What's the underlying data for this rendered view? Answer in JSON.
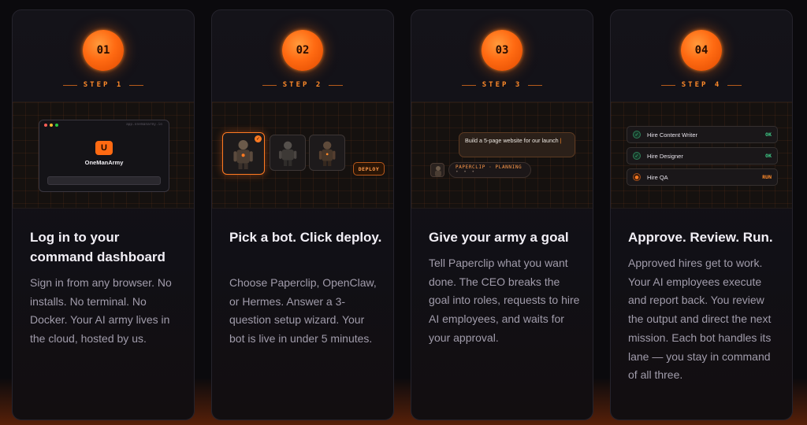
{
  "colors": {
    "accent": "#ff6a12",
    "ok": "#3fd08a",
    "background": "#0b0a0d"
  },
  "steps": [
    {
      "number": "01",
      "label": "STEP 1",
      "title": "Log in to your command dashboard",
      "description": "Sign in from any browser. No installs. No terminal. No Docker. Your AI army lives in the cloud, hosted by us.",
      "visual": {
        "window_url": "app.onemanarmy.io",
        "logo_letter": "U",
        "app_name": "OneManArmy"
      }
    },
    {
      "number": "02",
      "label": "STEP 2",
      "title": "Pick a bot. Click deploy.",
      "description": "Choose Paperclip, OpenClaw, or Hermes. Answer a 3-question setup wizard. Your bot is live in under 5 minutes.",
      "visual": {
        "bots": [
          "paperclip-bot",
          "openclaw-bot",
          "hermes-bot"
        ],
        "selected_check": "✓",
        "deploy_label": "DEPLOY"
      }
    },
    {
      "number": "03",
      "label": "STEP 3",
      "title": "Give your army a goal",
      "description": "Tell Paperclip what you want done. The CEO breaks the goal into roles, requests to hire AI employees, and waits for your approval.",
      "visual": {
        "message": "Build a 5-page website for our launch",
        "agent_status": "PAPERCLIP · PLANNING"
      }
    },
    {
      "number": "04",
      "label": "STEP 4",
      "title": "Approve. Review. Run.",
      "description": "Approved hires get to work. Your AI employees execute and report back. You review the output and direct the next mission. Each bot handles its lane — you stay in command of all three.",
      "visual": {
        "hires": [
          {
            "label": "Hire Content Writer",
            "status": "OK",
            "icon": "✓"
          },
          {
            "label": "Hire Designer",
            "status": "OK",
            "icon": "✓"
          },
          {
            "label": "Hire QA",
            "status": "RUN",
            "icon": "●"
          }
        ]
      }
    }
  ]
}
